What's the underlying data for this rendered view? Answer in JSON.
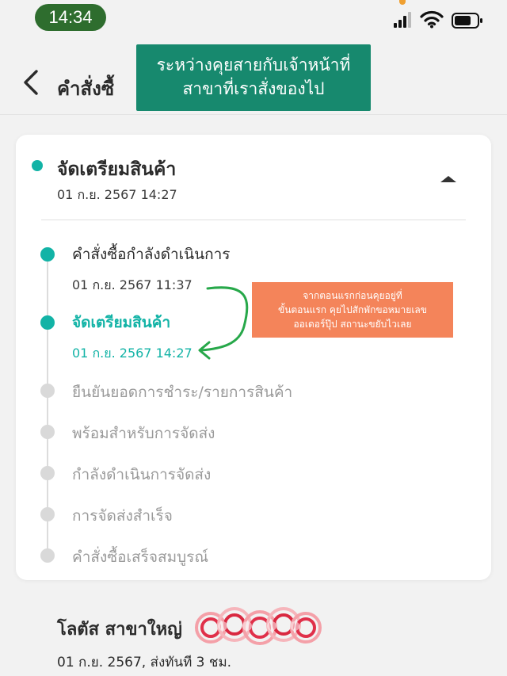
{
  "status_bar": {
    "time": "14:34"
  },
  "header": {
    "title": "คำสั่งซื้"
  },
  "teal_callout": {
    "line1": "ระหว่างคุยสายกับเจ้าหน้าที่",
    "line2": "สาขาที่เราสั่งของไป"
  },
  "current_status": {
    "title": "จัดเตรียมสินค้า",
    "date": "01 ก.ย. 2567 14:27"
  },
  "timeline": [
    {
      "label": "คำสั่งซื้อกำลังดำเนินการ",
      "date": "01 ก.ย. 2567 11:37",
      "state": "done"
    },
    {
      "label": "จัดเตรียมสินค้า",
      "date": "01 ก.ย. 2567 14:27",
      "state": "current"
    },
    {
      "label": "ยืนยันยอดการชำระ/รายการสินค้า",
      "state": "pending"
    },
    {
      "label": "พร้อมสำหรับการจัดส่ง",
      "state": "pending"
    },
    {
      "label": "กำลังดำเนินการจัดส่ง",
      "state": "pending"
    },
    {
      "label": "การจัดส่งสำเร็จ",
      "state": "pending"
    },
    {
      "label": "คำสั่งซื้อเสร็จสมบูรณ์",
      "state": "pending"
    }
  ],
  "orange_callout": {
    "line1": "จากตอนแรกก่อนคุยอยู่ที่",
    "line2": "ขั้นตอนแรก คุยไปสักพักขอหมายเลข",
    "line3": "ออเดอร์ปุ๊ป สถานะขยับไวเลย"
  },
  "store": {
    "name": "โลตัส สาขาใหญ่",
    "info": "01 ก.ย. 2567, ส่งทันที 3 ชม."
  },
  "colors": {
    "teal": "#12b3a6",
    "pending": "#d9d9d9",
    "callout_teal": "#17896e",
    "callout_orange": "#f4845a",
    "arrow_green": "#27a84a"
  },
  "icons": [
    "back-chevron-icon",
    "signal-icon",
    "wifi-icon",
    "battery-icon",
    "caret-up-icon",
    "curved-arrow-icon"
  ]
}
